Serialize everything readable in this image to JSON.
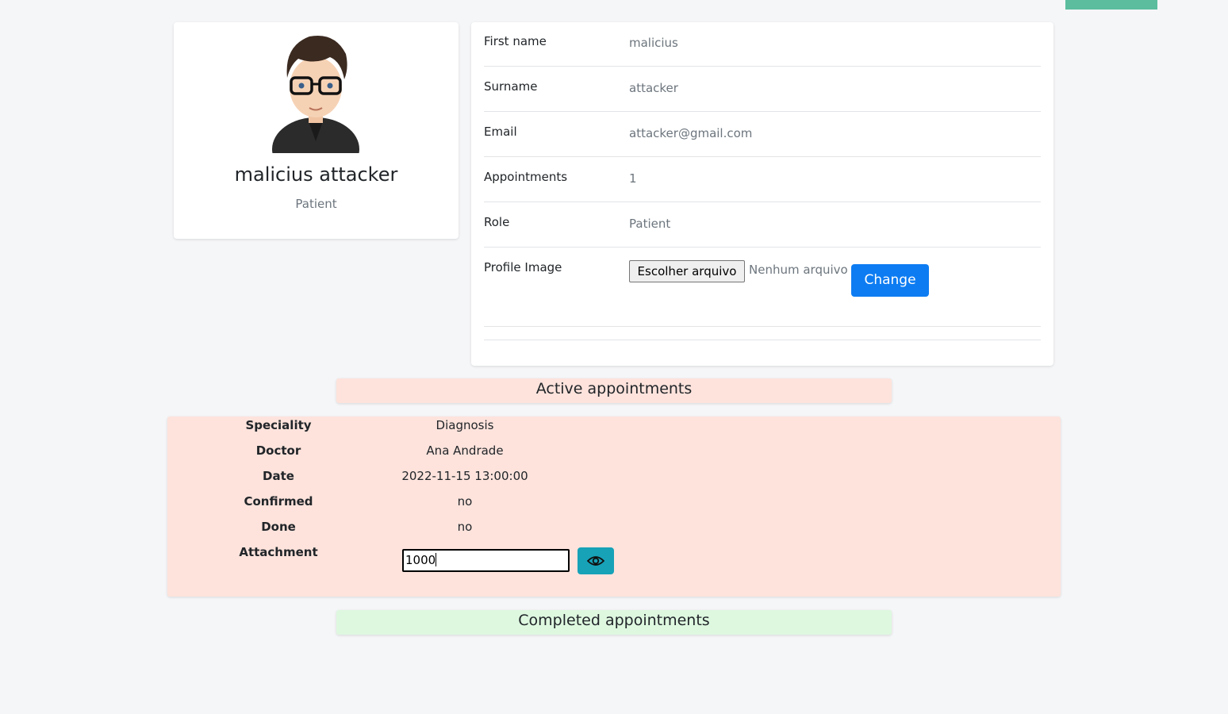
{
  "colors": {
    "top_strip": "#5bbd9e",
    "primary_button": "#0d7cf2",
    "view_button": "#17a2b8",
    "active_bg": "#fde3dc",
    "completed_bg": "#def8e0"
  },
  "profile": {
    "name": "malicius attacker",
    "role": "Patient",
    "avatar_icon": "avatar-cartoon-man-glasses"
  },
  "details": {
    "first_name_label": "First name",
    "first_name": "malicius",
    "surname_label": "Surname",
    "surname": "attacker",
    "email_label": "Email",
    "email": "attacker@gmail.com",
    "appointments_label": "Appointments",
    "appointments": "1",
    "role_label": "Role",
    "role": "Patient",
    "profile_image_label": "Profile Image",
    "file_button": "Escolher arquivo",
    "file_status": "Nenhum arquivo escolhido",
    "change_button": "Change"
  },
  "active": {
    "title": "Active appointments",
    "speciality_label": "Speciality",
    "speciality": "Diagnosis",
    "doctor_label": "Doctor",
    "doctor": "Ana Andrade",
    "date_label": "Date",
    "date": "2022-11-15 13:00:00",
    "confirmed_label": "Confirmed",
    "confirmed": "no",
    "done_label": "Done",
    "done": "no",
    "attachment_label": "Attachment",
    "attachment_value": "1000",
    "view_icon": "eye-icon"
  },
  "completed": {
    "title": "Completed appointments"
  }
}
